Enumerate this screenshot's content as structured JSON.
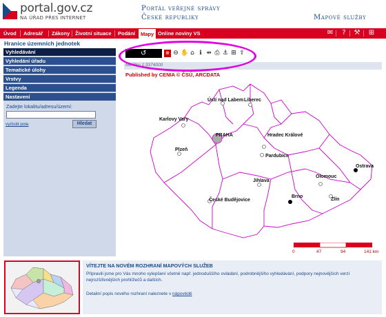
{
  "header": {
    "logo_text": "portal.gov.cz",
    "logo_sub": "NA ÚŘAD PŘES INTERNET",
    "portal_title_line1": "Portál veřejné správy",
    "portal_title_line2": "České republiky",
    "map_services": "Mapové služby"
  },
  "nav": {
    "items": [
      "Úvod",
      "Adresář",
      "Zákony",
      "Životní situace",
      "Podání",
      "Mapy",
      "Online noviny VS"
    ],
    "active": "Mapy"
  },
  "page_subtitle": "Hranice územních jednotek",
  "sidebar": {
    "items": [
      "Vyhledávání",
      "Vyhledání úřadu",
      "Tematické úlohy",
      "Vrstvy",
      "Legenda",
      "Nastavení"
    ],
    "search_label": "Zadejte lokalitu/adresu/území:",
    "search_value": "",
    "clear_link": "vyčistit pole",
    "search_button": "Hledat"
  },
  "map": {
    "scale_text": "Měřítko 1:3374000",
    "published": "Published by CENIA  © ČSÚ, ARCDATA",
    "cities": [
      {
        "name": "Ústí nad Labem"
      },
      {
        "name": "Liberec"
      },
      {
        "name": "Karlovy Vary"
      },
      {
        "name": "PRAHA"
      },
      {
        "name": "Hradec Králové"
      },
      {
        "name": "Plzeň"
      },
      {
        "name": "Pardubice"
      },
      {
        "name": "Ostrava"
      },
      {
        "name": "Olomouc"
      },
      {
        "name": "Jihlava"
      },
      {
        "name": "Brno"
      },
      {
        "name": "Zlín"
      },
      {
        "name": "České Budějovice"
      }
    ],
    "scale_labels": [
      "0",
      "47",
      "94",
      "141 km"
    ]
  },
  "news": {
    "title": "VÍTEJTE NA NOVÉM ROZHRANÍ MAPOVÝCH SLUŽEB",
    "text": "Připravili jsme pro Vás mnoho vylepšení včetně např. jednoduššího ovládání, podrobnějšího vyhledávání, podpory nejnovějších verzí nejrozšířenějších prohlížečů a dalších.",
    "link_prefix": "Detailní popis nového rozhraní naleznete v",
    "link_text": "nápovědě"
  },
  "colors": {
    "nav_red": "#d8001e",
    "sidebar_blue": "#2c4f90",
    "region_border": "#cc00cc",
    "highlight": "#e000e0"
  }
}
